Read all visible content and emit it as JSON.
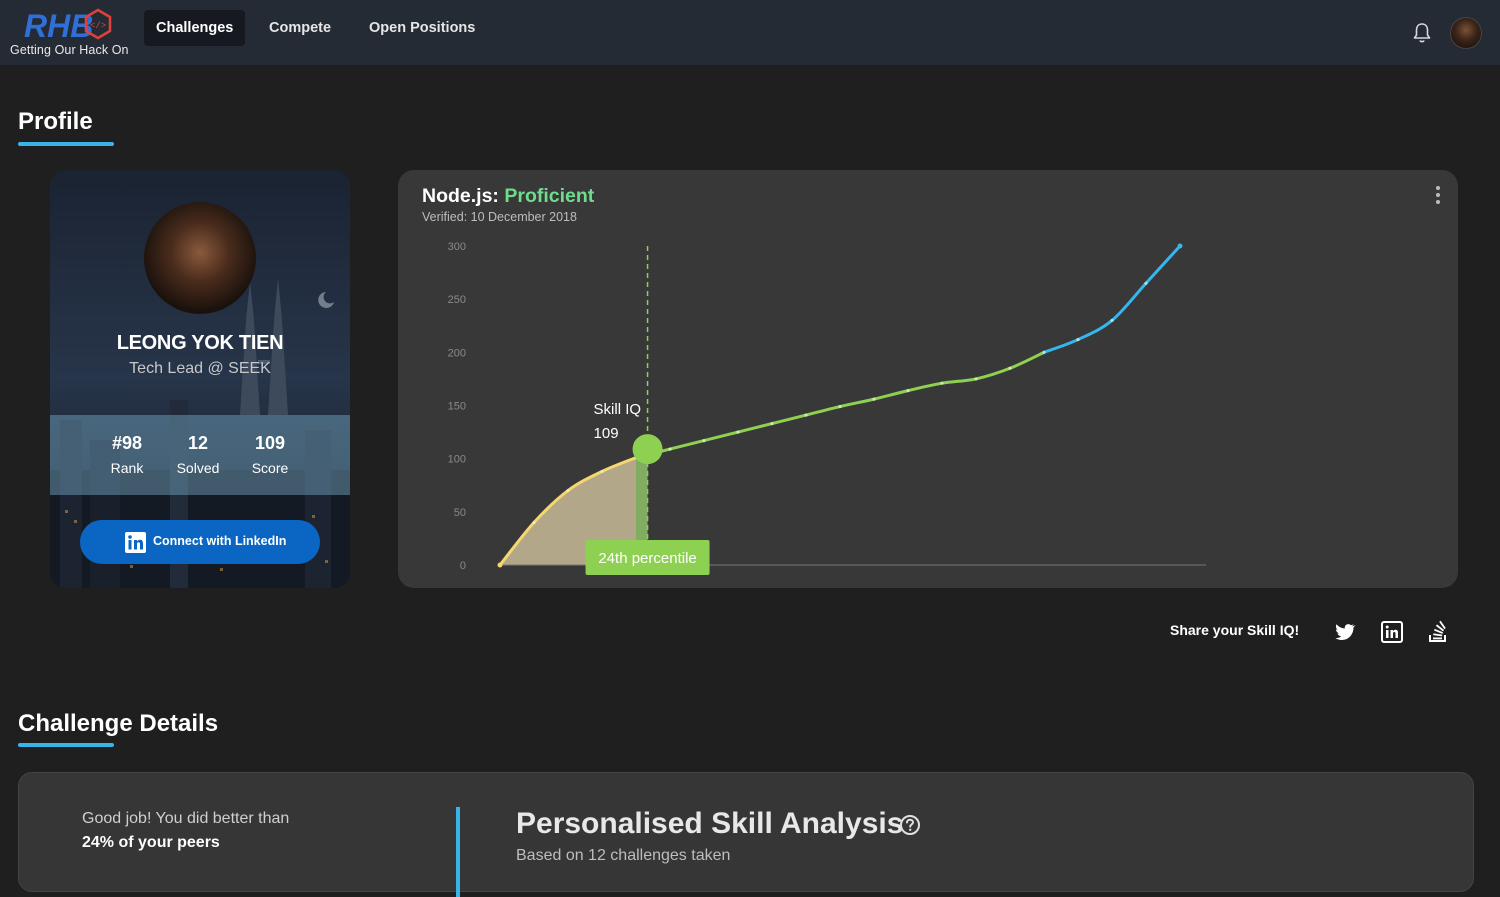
{
  "brand": {
    "logo_text": "RHB",
    "tagline": "Getting Our Hack On"
  },
  "nav": {
    "items": [
      {
        "label": "Challenges",
        "active": true
      },
      {
        "label": "Compete",
        "active": false
      },
      {
        "label": "Open Positions",
        "active": false
      }
    ],
    "bell_icon": "bell-icon",
    "avatar_icon": "user-avatar"
  },
  "profile": {
    "section_title": "Profile",
    "name": "LEONG YOK TIEN",
    "job_title": "Tech Lead @ SEEK",
    "stats": [
      {
        "value": "#98",
        "label": "Rank"
      },
      {
        "value": "12",
        "label": "Solved"
      },
      {
        "value": "109",
        "label": "Score"
      }
    ],
    "linkedin_label": "Connect with LinkedIn"
  },
  "skill_card": {
    "skill": "Node.js:",
    "level": "Proficient",
    "verified": "Verified: 10 December 2018",
    "marker_title": "Skill IQ",
    "marker_value": "109",
    "percentile_label": "24th percentile",
    "colors": {
      "low": "#f5d76e",
      "mid": "#8ed152",
      "high": "#35b6ef",
      "accent": "#6fdc8c"
    }
  },
  "chart_data": {
    "type": "area",
    "title": "",
    "xlabel": "",
    "ylabel": "",
    "ylim": [
      0,
      300
    ],
    "yticks": [
      "0",
      "50",
      "100",
      "150",
      "200",
      "250",
      "300"
    ],
    "x": [
      0,
      5,
      10,
      15,
      20,
      25,
      30,
      35,
      40,
      45,
      50,
      55,
      60,
      65,
      70,
      75,
      80,
      85,
      90,
      95,
      100
    ],
    "y": [
      0,
      40,
      70,
      88,
      101,
      109,
      117,
      125,
      133,
      141,
      149,
      156,
      164,
      171,
      175,
      185,
      200,
      212,
      230,
      265,
      300
    ],
    "marker": {
      "x": 21.7,
      "y": 109,
      "label": "Skill IQ"
    },
    "segments": [
      {
        "name": "low",
        "to_y": 100
      },
      {
        "name": "mid",
        "to_y": 200
      },
      {
        "name": "high",
        "to_y": 300
      }
    ],
    "grid": false
  },
  "share": {
    "label": "Share your Skill IQ!",
    "icons": [
      "twitter-icon",
      "linkedin-icon",
      "stackoverflow-icon"
    ]
  },
  "details": {
    "section_title": "Challenge Details",
    "line1": "Good job! You did better than",
    "line2": "24% of your peers",
    "analysis_title": "Personalised Skill Analysis",
    "analysis_sub": "Based on 12 challenges taken"
  }
}
